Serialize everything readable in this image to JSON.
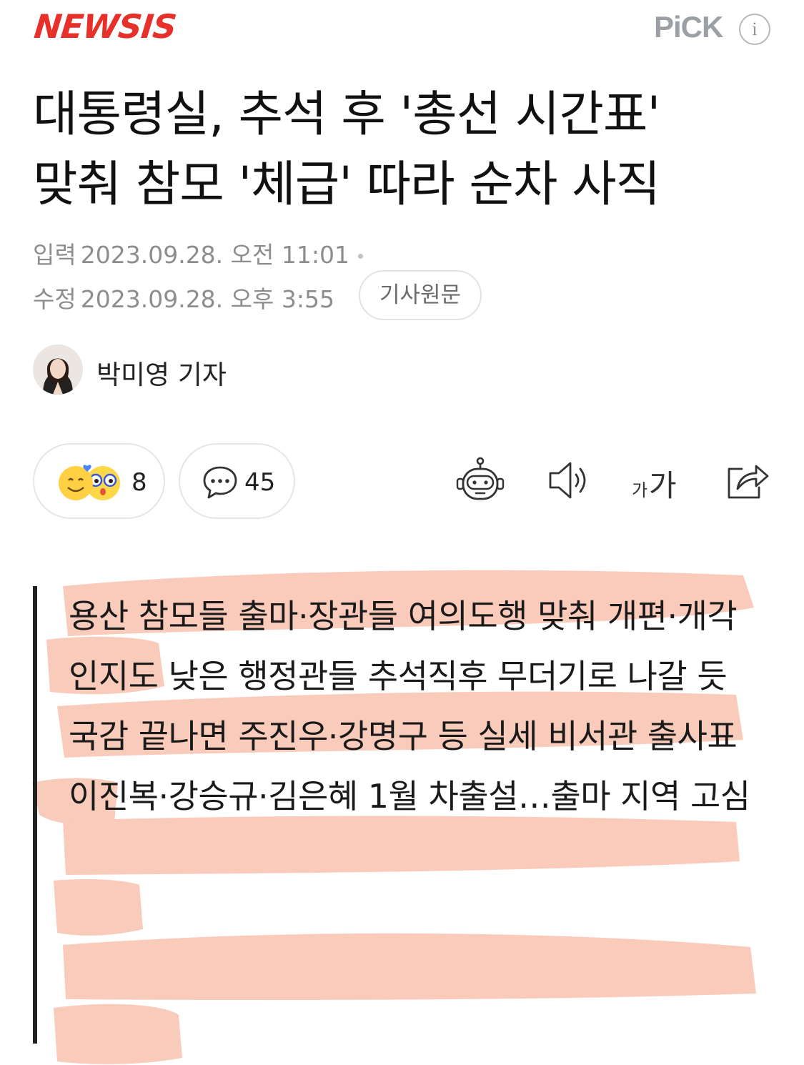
{
  "header": {
    "logo": "NEWSIS",
    "pick_label": "PiCK",
    "info_icon": "info-icon"
  },
  "article": {
    "title_line1": "대통령실, 추석 후 '총선 시간표'",
    "title_line2": "맞춰 참모 '체급' 따라 순차 사직",
    "input_label": "입력",
    "input_time": "2023.09.28. 오전 11:01",
    "modified_label": "수정",
    "modified_time": "2023.09.28. 오후 3:55",
    "original_button": "기사원문",
    "reporter": "박미영 기자"
  },
  "actions": {
    "reaction_count": "8",
    "comment_count": "45",
    "font_small": "가",
    "font_large": "가",
    "icons": [
      "bot-icon",
      "speaker-icon",
      "font-size-icon",
      "share-icon"
    ]
  },
  "summary": {
    "lines": [
      "용산 참모들 출마·장관들 여의도행 맞춰 개편·개각",
      "인지도 낮은 행정관들 추석직후 무더기로 나갈 듯",
      "국감 끝나면 주진우·강명구 등 실세 비서관 출사표",
      "이진복·강승규·김은혜 1월 차출설…출마 지역 고심"
    ],
    "highlight_color": "#f5a183"
  },
  "colors": {
    "brand": "#e8302a",
    "meta": "#8d8d8d"
  }
}
